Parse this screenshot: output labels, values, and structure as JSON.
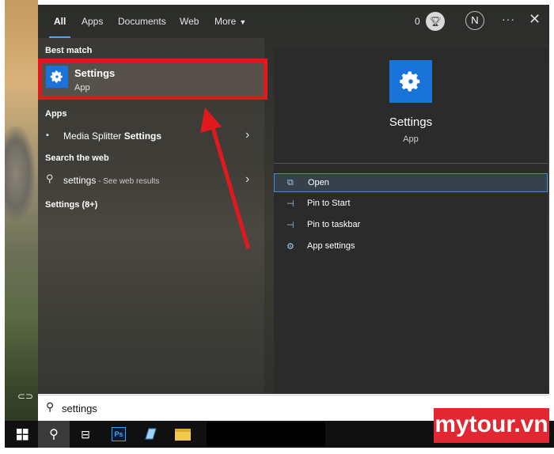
{
  "tabs": [
    {
      "label": "All",
      "active": true
    },
    {
      "label": "Apps"
    },
    {
      "label": "Documents"
    },
    {
      "label": "Web"
    },
    {
      "label": "More"
    }
  ],
  "header": {
    "reward_count": "0",
    "avatar_initial": "N",
    "more_dots": "···",
    "close": "✕"
  },
  "best_match": {
    "section_label": "Best match",
    "title": "Settings",
    "subtitle": "App"
  },
  "apps_section": {
    "label": "Apps",
    "item_prefix": "Media Splitter ",
    "item_bold": "Settings"
  },
  "web_section": {
    "label": "Search the web",
    "query": "settings",
    "suffix": " - See web results"
  },
  "settings_count_label": "Settings (8+)",
  "detail": {
    "title": "Settings",
    "subtitle": "App",
    "actions": [
      {
        "label": "Open",
        "icon": "open-icon",
        "highlighted": true
      },
      {
        "label": "Pin to Start",
        "icon": "pin-icon"
      },
      {
        "label": "Pin to taskbar",
        "icon": "pin-icon"
      },
      {
        "label": "App settings",
        "icon": "gear-icon"
      }
    ]
  },
  "search": {
    "value": "settings"
  },
  "taskbar": {
    "photoshop_label": "Ps"
  },
  "watermark": "mytour.vn",
  "colors": {
    "accent": "#1a73d9",
    "highlight_border": "#e0191e",
    "tab_underline": "#4aa3ff"
  }
}
